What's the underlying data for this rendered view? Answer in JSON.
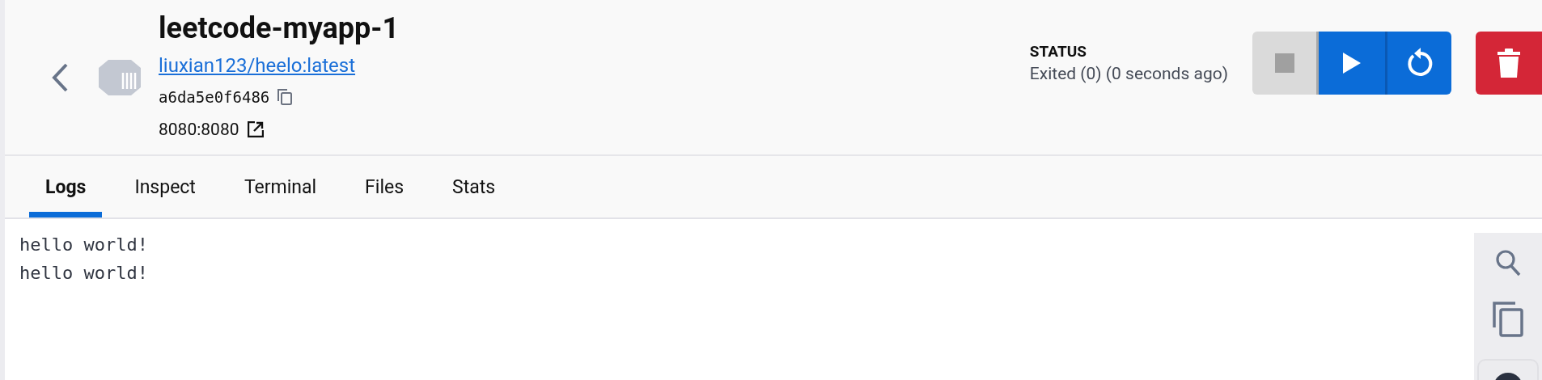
{
  "container": {
    "name": "leetcode-myapp-1",
    "image": "liuxian123/heelo:latest",
    "id": "a6da5e0f6486",
    "port": "8080:8080"
  },
  "status": {
    "label": "STATUS",
    "value": "Exited (0) (0 seconds ago)"
  },
  "actions": [
    {
      "kind": "stop",
      "disabled": true
    },
    {
      "kind": "start",
      "disabled": false
    },
    {
      "kind": "restart",
      "disabled": false
    },
    {
      "kind": "delete",
      "disabled": false
    }
  ],
  "tabs": [
    {
      "label": "Logs",
      "selected": true
    },
    {
      "label": "Inspect",
      "selected": false
    },
    {
      "label": "Terminal",
      "selected": false
    },
    {
      "label": "Files",
      "selected": false
    },
    {
      "label": "Stats",
      "selected": false
    }
  ],
  "logs": [
    "hello world!",
    "hello world!"
  ]
}
